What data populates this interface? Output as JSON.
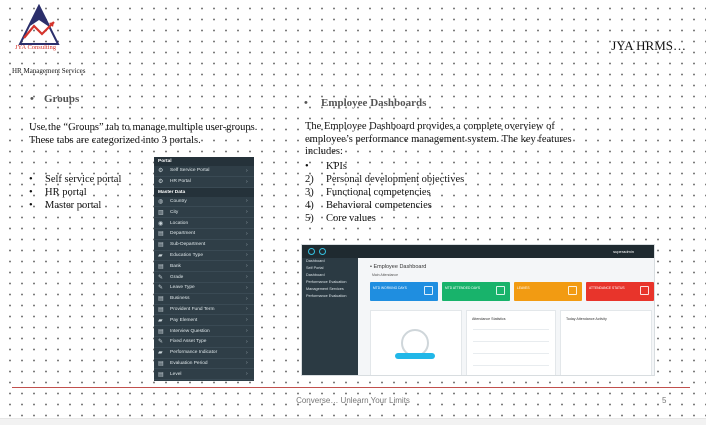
{
  "logo": {
    "text": "JYA Consulting",
    "colors": {
      "triangle_dark": "#2b2f6b",
      "triangle_red": "#d4342c"
    }
  },
  "brand": "JYA HRMS…",
  "subtitle": "HR Management Services",
  "groups": {
    "bullet": "•",
    "heading": "Groups",
    "description": "Use the “Groups” tab to manage multiple user-groups. These tabs are categorized into 3 portals.",
    "portals": [
      "Self service portal",
      "HR portal",
      "Master portal"
    ]
  },
  "sidebar_screenshot": {
    "sections": [
      {
        "title": "Portal",
        "items": [
          {
            "icon": "gear-icon",
            "glyph": "⚙",
            "label": "Self Service Portal"
          },
          {
            "icon": "gear-icon",
            "glyph": "⚙",
            "label": "HR Portal"
          }
        ]
      },
      {
        "title": "Master Data",
        "items": [
          {
            "icon": "globe-icon",
            "glyph": "◍",
            "label": "Country"
          },
          {
            "icon": "city-icon",
            "glyph": "▥",
            "label": "City"
          },
          {
            "icon": "location-icon",
            "glyph": "◉",
            "label": "Location"
          },
          {
            "icon": "bank-icon",
            "glyph": "▤",
            "label": "Department"
          },
          {
            "icon": "bank-icon",
            "glyph": "▤",
            "label": "Sub-Department"
          },
          {
            "icon": "education-icon",
            "glyph": "▰",
            "label": "Education Type"
          },
          {
            "icon": "bank-icon",
            "glyph": "▤",
            "label": "Bank"
          },
          {
            "icon": "grade-icon",
            "glyph": "✎",
            "label": "Grade"
          },
          {
            "icon": "leave-icon",
            "glyph": "✎",
            "label": "Leave Type"
          },
          {
            "icon": "business-icon",
            "glyph": "▤",
            "label": "Business"
          },
          {
            "icon": "fund-icon",
            "glyph": "▤",
            "label": "Provident Fund Term"
          },
          {
            "icon": "pay-icon",
            "glyph": "▰",
            "label": "Pay Element"
          },
          {
            "icon": "question-icon",
            "glyph": "▤",
            "label": "Interview Question"
          },
          {
            "icon": "asset-icon",
            "glyph": "✎",
            "label": "Fixed Asset Type"
          },
          {
            "icon": "indicator-icon",
            "glyph": "▰",
            "label": "Performance Indicator"
          },
          {
            "icon": "evaluation-icon",
            "glyph": "▤",
            "label": "Evaluation Period"
          },
          {
            "icon": "level-icon",
            "glyph": "▤",
            "label": "Level"
          }
        ]
      }
    ],
    "chevron": "›"
  },
  "dashboard": {
    "bullet": "•",
    "heading": "Employee Dashboards",
    "description": "The Employee Dashboard provides a complete overview of employee’s performance management system. The key features includes:",
    "features": [
      {
        "num": "•",
        "label": "KPIs"
      },
      {
        "num": "2)",
        "label": "Personal development objectives"
      },
      {
        "num": "3)",
        "label": "Functional competencies"
      },
      {
        "num": "4)",
        "label": "Behavioral competencies"
      },
      {
        "num": "5)",
        "label": "Core values"
      }
    ]
  },
  "dashboard_screenshot": {
    "title": "• Employee Dashboard",
    "tabs": "Main     Attendance",
    "user": "superadmin",
    "side_items": [
      "Dashboard",
      "Self Portal",
      "Dashboard",
      "Performance Evaluation",
      "Management Services",
      "Performance Evaluation"
    ],
    "cards": [
      {
        "label": "MTD WORKING DAYS",
        "color": "#1f8ee0"
      },
      {
        "label": "MTD ATTENDED DAYS",
        "color": "#18b36b"
      },
      {
        "label": "LEAVES",
        "color": "#f29b12"
      },
      {
        "label": "ATTENDANCE STATUS",
        "color": "#e8342b"
      }
    ],
    "panels": [
      "",
      "Attendance Statistics",
      "Today Attendance Activity"
    ]
  },
  "footer": {
    "text": "Converse… Unlearn Your Limits",
    "page": "5",
    "rule_color": "#c1504d"
  }
}
